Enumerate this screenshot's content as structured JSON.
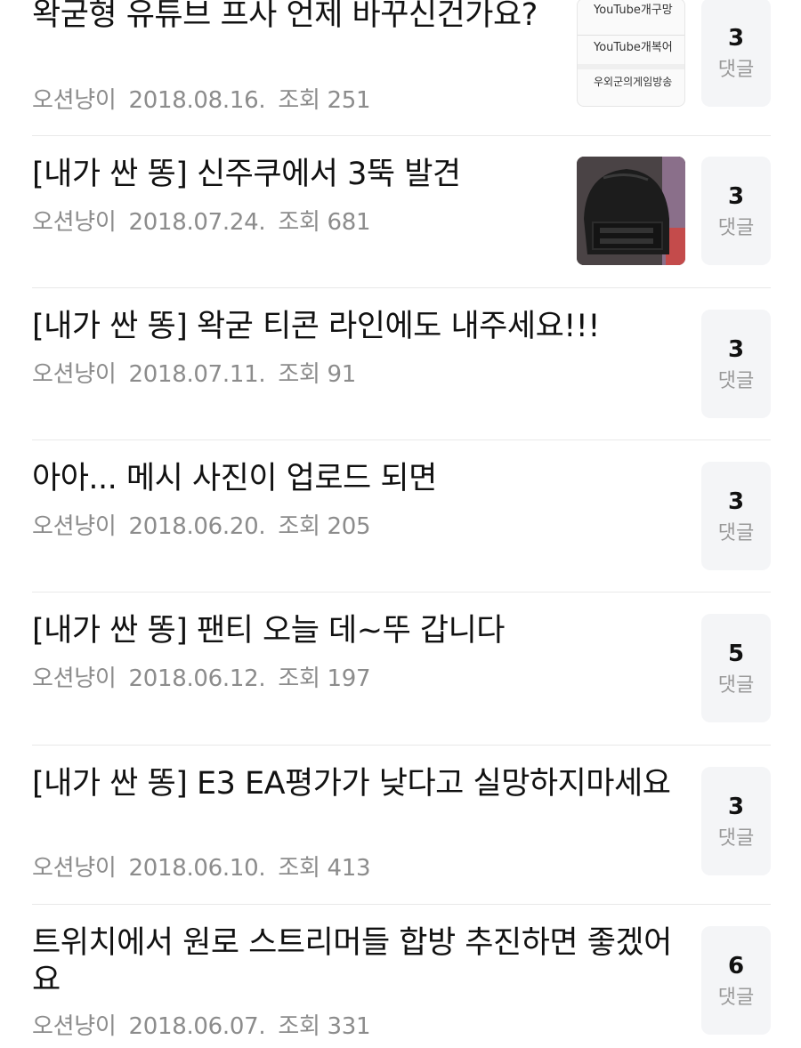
{
  "comment_label": "댓글",
  "posts": [
    {
      "title": "왁굳형 유튜브 프사 언제 바꾸신건가요?",
      "author": "오션냥이",
      "date": "2018.08.16.",
      "views": "조회 251",
      "comments": "3",
      "has_thumb": true,
      "thumb": "youtube-list-screenshot"
    },
    {
      "title": "[내가 싼 똥] 신주쿠에서 3뚝 발견",
      "author": "오션냥이",
      "date": "2018.07.24.",
      "views": "조회 681",
      "comments": "3",
      "has_thumb": true,
      "thumb": "helmet-photo"
    },
    {
      "title": "[내가 싼 똥] 왁굳 티콘 라인에도 내주세요!!!",
      "author": "오션냥이",
      "date": "2018.07.11.",
      "views": "조회 91",
      "comments": "3",
      "has_thumb": false
    },
    {
      "title": "아아... 메시 사진이 업로드 되면",
      "author": "오션냥이",
      "date": "2018.06.20.",
      "views": "조회 205",
      "comments": "3",
      "has_thumb": false
    },
    {
      "title": "[내가 싼 똥] 팬티 오늘 데~뚜 갑니다",
      "author": "오션냥이",
      "date": "2018.06.12.",
      "views": "조회 197",
      "comments": "5",
      "has_thumb": false
    },
    {
      "title": "[내가 싼 똥] E3 EA평가가 낮다고 실망하지마세요",
      "author": "오션냥이",
      "date": "2018.06.10.",
      "views": "조회 413",
      "comments": "3",
      "has_thumb": false
    },
    {
      "title": "트위치에서 원로 스트리머들 합방 추진하면 좋겠어요",
      "author": "오션냥이",
      "date": "2018.06.07.",
      "views": "조회 331",
      "comments": "6",
      "has_thumb": false
    }
  ],
  "thumb_youtube_rows": [
    "YouTube개구망",
    "YouTube개복어",
    "우외군의게임방송"
  ]
}
